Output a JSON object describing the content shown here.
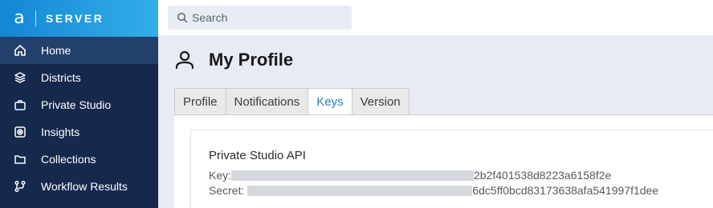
{
  "brand": {
    "mark": "a",
    "name": "SERVER"
  },
  "search": {
    "placeholder": "Search"
  },
  "sidebar": {
    "items": [
      {
        "label": "Home",
        "icon": "home-icon",
        "active": true
      },
      {
        "label": "Districts",
        "icon": "layers-icon",
        "active": false
      },
      {
        "label": "Private Studio",
        "icon": "briefcase-icon",
        "active": false
      },
      {
        "label": "Insights",
        "icon": "insights-icon",
        "active": false
      },
      {
        "label": "Collections",
        "icon": "folder-icon",
        "active": false
      },
      {
        "label": "Workflow Results",
        "icon": "workflow-icon",
        "active": false
      }
    ]
  },
  "page": {
    "title": "My Profile",
    "icon": "user-icon"
  },
  "tabs": [
    {
      "label": "Profile",
      "active": false
    },
    {
      "label": "Notifications",
      "active": false
    },
    {
      "label": "Keys",
      "active": true
    },
    {
      "label": "Version",
      "active": false
    }
  ],
  "keys": {
    "section_title": "Private Studio API",
    "key_label": "Key:",
    "key_value": "2b2f401538d8223a6158f2e",
    "secret_label": "Secret:",
    "secret_value": "6dc5ff0bcd83173638afa541997f1dee"
  },
  "colors": {
    "sidebar_bg": "#15294d",
    "sidebar_active": "#233f6b",
    "brand_gradient_start": "#1486d4",
    "brand_gradient_end": "#33aee8",
    "active_tab_text": "#1f7fbf",
    "content_bg": "#e8ebf4"
  }
}
